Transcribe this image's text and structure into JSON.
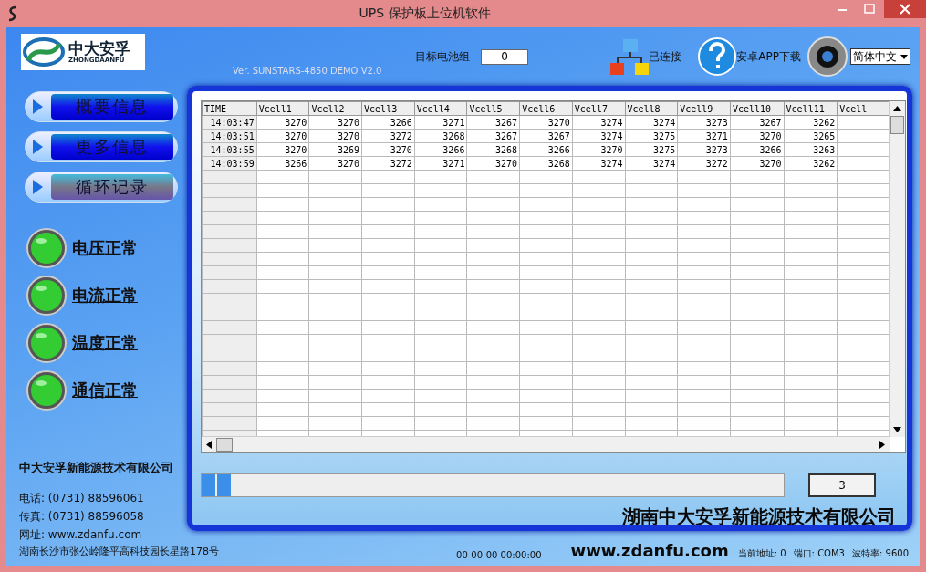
{
  "window": {
    "title": "UPS 保护板上位机软件"
  },
  "header": {
    "logo_text": "中大安孚",
    "logo_subtext": "ZHONGDAANFU",
    "version": "Ver. SUNSTARS-4850 DEMO V2.0",
    "target_label": "目标电池组",
    "target_value": "0",
    "connection": "已连接",
    "app_download": "安卓APP下载",
    "language": "简体中文"
  },
  "nav": [
    {
      "label": "概要信息",
      "selected": false
    },
    {
      "label": "更多信息",
      "selected": false
    },
    {
      "label": "循环记录",
      "selected": true
    }
  ],
  "status": [
    {
      "label": "电压正常",
      "ok": true
    },
    {
      "label": "电流正常",
      "ok": true
    },
    {
      "label": "温度正常",
      "ok": true
    },
    {
      "label": "通信正常",
      "ok": true
    }
  ],
  "company": {
    "name": "中大安孚新能源技术有限公司",
    "phone": "电话: (0731) 88596061",
    "fax": "传真: (0731) 88596058",
    "web": "网址: www.zdanfu.com",
    "address": "湖南长沙市张公岭隆平高科技园长星路178号"
  },
  "table": {
    "columns": [
      "TIME",
      "Vcell1",
      "Vcell2",
      "Vcell3",
      "Vcell4",
      "Vcell5",
      "Vcell6",
      "Vcell7",
      "Vcell8",
      "Vcell9",
      "Vcell10",
      "Vcell11",
      "Vcell"
    ],
    "rows": [
      [
        "14:03:47",
        "3270",
        "3270",
        "3266",
        "3271",
        "3267",
        "3270",
        "3274",
        "3274",
        "3273",
        "3267",
        "3262"
      ],
      [
        "14:03:51",
        "3270",
        "3270",
        "3272",
        "3268",
        "3267",
        "3267",
        "3274",
        "3275",
        "3271",
        "3270",
        "3265"
      ],
      [
        "14:03:55",
        "3270",
        "3269",
        "3270",
        "3266",
        "3268",
        "3266",
        "3270",
        "3275",
        "3273",
        "3266",
        "3263"
      ],
      [
        "14:03:59",
        "3266",
        "3270",
        "3272",
        "3271",
        "3270",
        "3268",
        "3274",
        "3274",
        "3272",
        "3270",
        "3262"
      ]
    ]
  },
  "progress": {
    "level": 0.05,
    "button": "3"
  },
  "banner": {
    "company": "湖南中大安孚新能源技术有限公司",
    "website": "www.zdanfu.com"
  },
  "status_bar": {
    "datetime": "00-00-00 00:00:00",
    "address": "当前地址: 0",
    "port": "端口: COM3",
    "baud": "波特率: 9600"
  }
}
